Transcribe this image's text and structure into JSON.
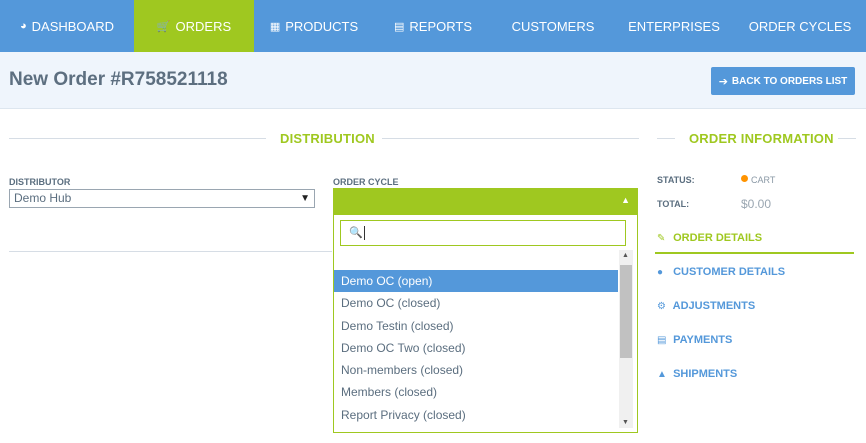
{
  "nav": {
    "items": [
      {
        "label": "DASHBOARD",
        "icon": "dashboard-icon"
      },
      {
        "label": "ORDERS",
        "icon": "cart-icon"
      },
      {
        "label": "PRODUCTS",
        "icon": "grid-icon"
      },
      {
        "label": "REPORTS",
        "icon": "document-icon"
      },
      {
        "label": "CUSTOMERS",
        "icon": ""
      },
      {
        "label": "ENTERPRISES",
        "icon": ""
      },
      {
        "label": "ORDER CYCLES",
        "icon": ""
      }
    ],
    "active": "ORDERS"
  },
  "header": {
    "title": "New Order #R758521118",
    "back_button": "BACK TO ORDERS LIST"
  },
  "distribution": {
    "heading": "DISTRIBUTION",
    "distributor_label": "DISTRIBUTOR",
    "distributor_value": "Demo Hub",
    "order_cycle_label": "ORDER CYCLE",
    "order_cycle_value": "",
    "search_value": "",
    "options": [
      "Demo OC (open)",
      "Demo OC (closed)",
      "Demo Testin (closed)",
      "Demo OC Two (closed)",
      "Non-members (closed)",
      "Members (closed)",
      "Report Privacy (closed)"
    ],
    "highlighted_option": "Demo OC (open)"
  },
  "order_info": {
    "heading": "ORDER INFORMATION",
    "status_label": "STATUS:",
    "status_value": "CART",
    "total_label": "TOTAL:",
    "total_value": "$0.00",
    "links": [
      {
        "label": "ORDER DETAILS",
        "icon": "edit-icon"
      },
      {
        "label": "CUSTOMER DETAILS",
        "icon": "user-icon"
      },
      {
        "label": "ADJUSTMENTS",
        "icon": "cogs-icon"
      },
      {
        "label": "PAYMENTS",
        "icon": "credit-card-icon"
      },
      {
        "label": "SHIPMENTS",
        "icon": "truck-icon"
      }
    ]
  },
  "colors": {
    "nav_bg": "#5498da",
    "accent_green": "#9fc820",
    "status_orange": "#ff9300"
  }
}
